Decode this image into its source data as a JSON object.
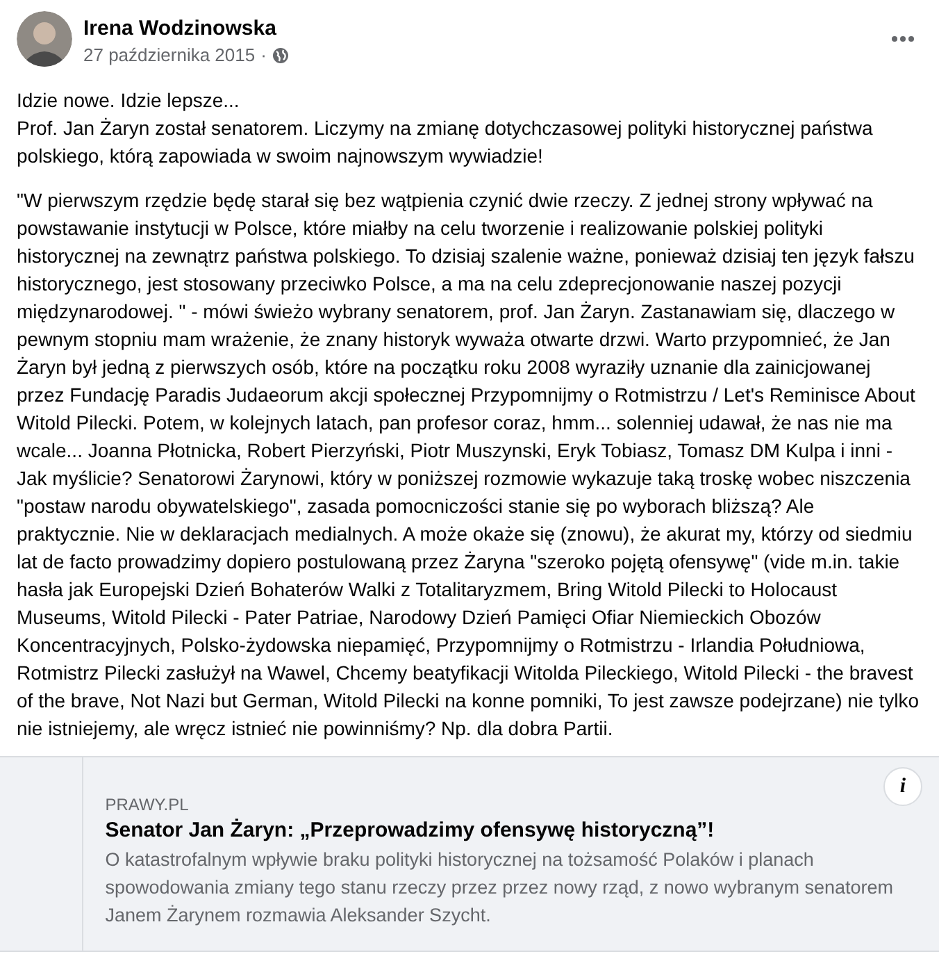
{
  "post": {
    "author": "Irena Wodzinowska",
    "date": "27 października 2015",
    "separator": "·"
  },
  "body": {
    "intro_lines": [
      "Idzie nowe. Idzie lepsze...",
      "Prof. Jan Żaryn został senatorem. Liczymy na zmianę dotychczasowej polityki historycznej państwa polskiego, którą zapowiada w swoim najnowszym wywiadzie!"
    ],
    "paragraph": "\"W pierwszym rzędzie będę starał się bez wątpienia czynić dwie rzeczy. Z jednej strony wpływać na powstawanie instytucji w Polsce, które miałby na celu tworzenie i realizowanie polskiej polityki historycznej na zewnątrz państwa polskiego. To dzisiaj szalenie ważne, ponieważ dzisiaj ten język fałszu historycznego, jest stosowany przeciwko Polsce, a ma na celu zdeprecjonowanie naszej pozycji międzynarodowej. \" - mówi świeżo wybrany senatorem, prof. Jan Żaryn. Zastanawiam się, dlaczego w pewnym stopniu mam wrażenie, że znany historyk wyważa otwarte drzwi. Warto przypomnieć, że Jan Żaryn był jedną z pierwszych osób, które na początku roku 2008 wyraziły uznanie dla zainicjowanej przez Fundację Paradis Judaeorum akcji społecznej Przypomnijmy o Rotmistrzu / Let's Reminisce About Witold Pilecki. Potem, w kolejnych latach, pan profesor coraz, hmm... solenniej udawał, że nas nie ma wcale... Joanna Płotnicka, Robert Pierzyński, Piotr Muszynski, Eryk Tobiasz, Tomasz DM Kulpa i inni - Jak myślicie? Senatorowi Żarynowi, który w poniższej rozmowie wykazuje taką troskę wobec niszczenia \"postaw narodu obywatelskiego\", zasada pomocniczości stanie się po wyborach bliższą? Ale praktycznie. Nie w deklaracjach medialnych. A może okaże się (znowu), że akurat my, którzy od siedmiu lat de facto prowadzimy dopiero postulowaną przez Żaryna \"szeroko pojętą ofensywę\" (vide m.in. takie hasła jak Europejski Dzień Bohaterów Walki z Totalitaryzmem, Bring Witold Pilecki to Holocaust Museums, Witold Pilecki - Pater Patriae, Narodowy Dzień Pamięci Ofiar Niemieckich Obozów Koncentracyjnych, Polsko-żydowska niepamięć, Przypomnijmy o Rotmistrzu - Irlandia Południowa, Rotmistrz Pilecki zasłużył na Wawel, Chcemy beatyfikacji Witolda Pileckiego, Witold Pilecki - the bravest of the brave, Not Nazi but German, Witold Pilecki na konne pomniki, To jest zawsze podejrzane) nie tylko nie istniejemy, ale wręcz istnieć nie powinniśmy? Np. dla dobra Partii."
  },
  "link_preview": {
    "domain": "PRAWY.PL",
    "title": "Senator Jan Żaryn: „Przeprowadzimy ofensywę historyczną”!",
    "description": "O katastrofalnym wpływie braku polityki historycznej na tożsamość Polaków i planach spowodowania zmiany tego stanu rzeczy przez przez nowy rząd, z nowo wybranym senatorem Janem Żarynem rozmawia Aleksander Szycht.",
    "info_label": "i"
  }
}
